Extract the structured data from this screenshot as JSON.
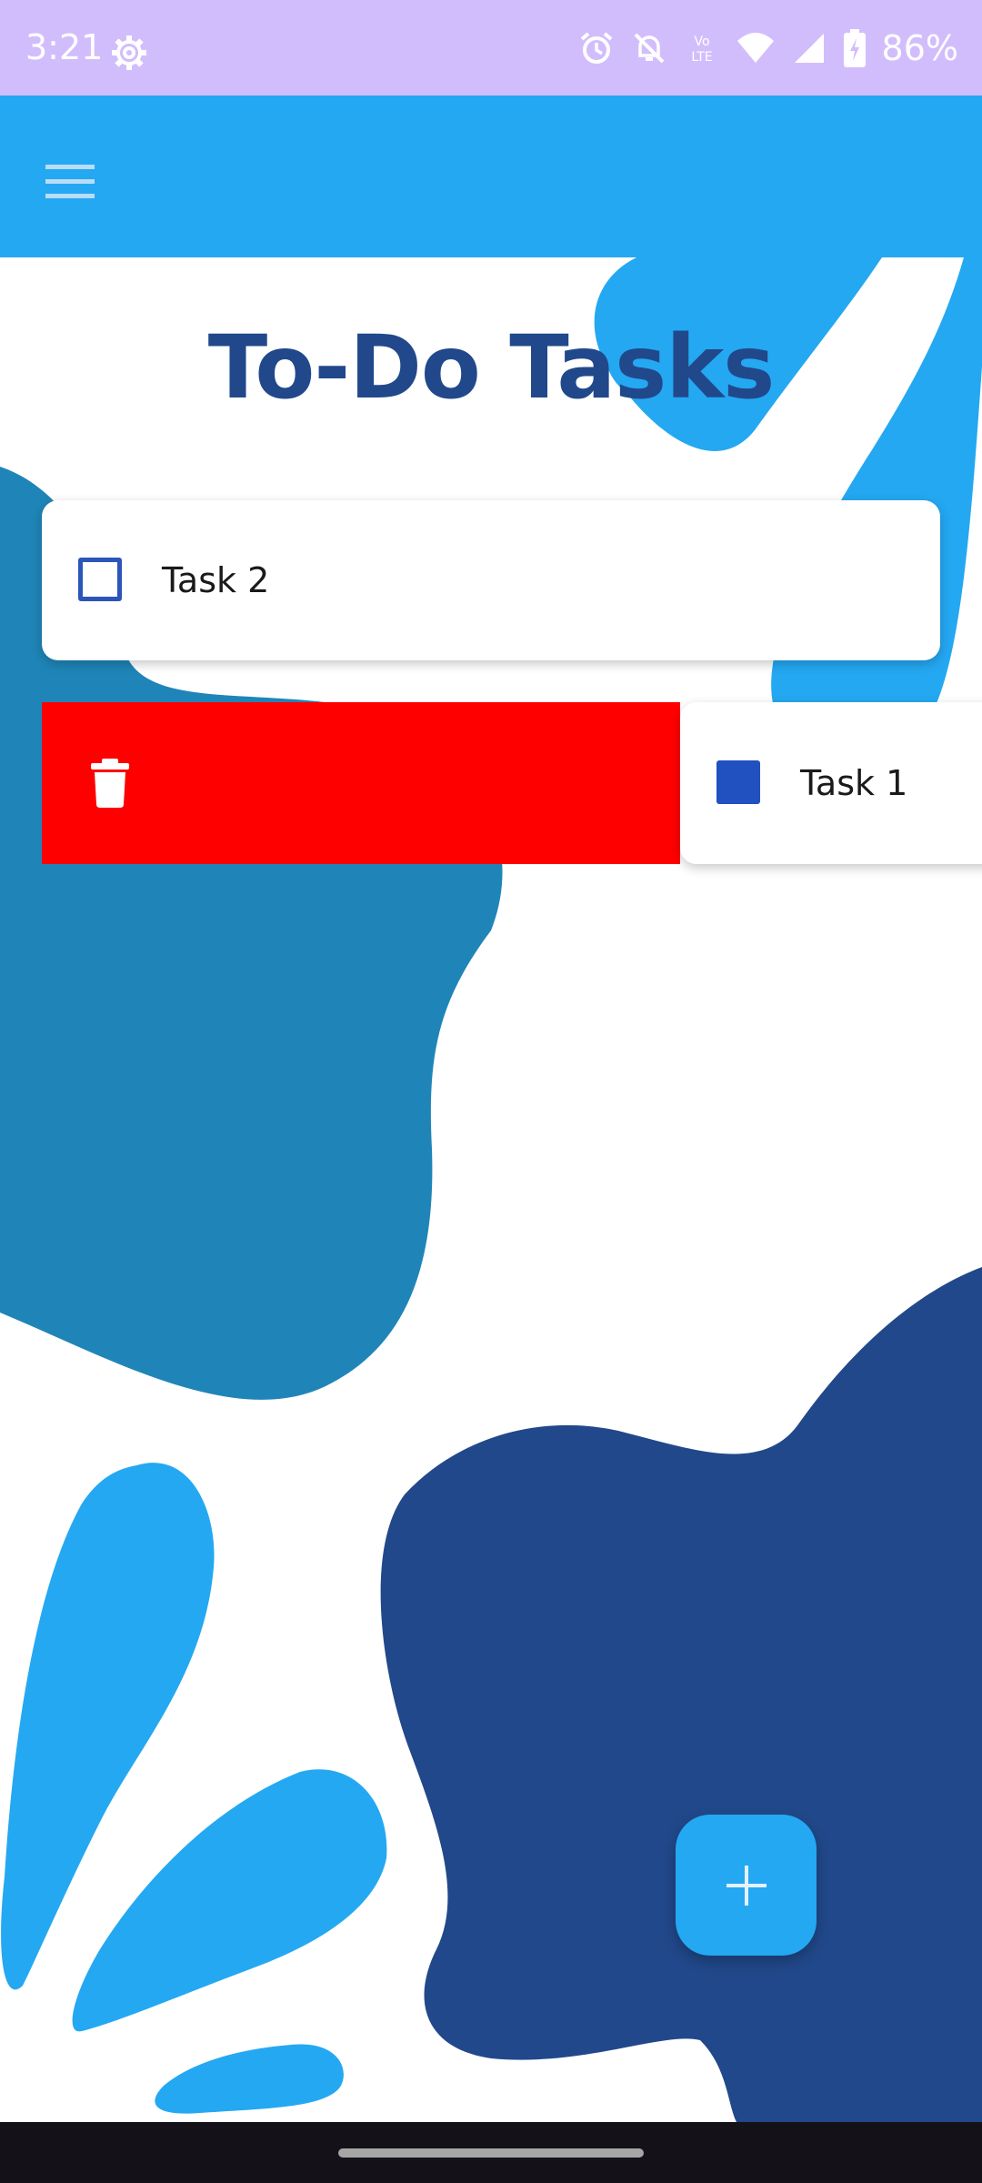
{
  "status_bar": {
    "time": "3:21",
    "battery": "86%",
    "icons": [
      "gear-icon",
      "alarm-icon",
      "bell-off-icon",
      "volte-icon",
      "wifi-icon",
      "signal-icon",
      "battery-charging-icon"
    ],
    "background_color": "#d2bdfc"
  },
  "app_bar": {
    "menu_icon": "hamburger-menu-icon",
    "background_color": "#24a8f2"
  },
  "main": {
    "title": "To-Do Tasks",
    "title_color": "#21488a",
    "tasks": [
      {
        "label": "Task 2",
        "checked": false
      },
      {
        "label": "Task 1",
        "checked": true,
        "swiped": true
      }
    ],
    "delete_action": {
      "icon": "trash-icon",
      "background_color": "#ff0000"
    }
  },
  "fab": {
    "icon": "plus-icon",
    "background_color": "#24a8f2"
  }
}
